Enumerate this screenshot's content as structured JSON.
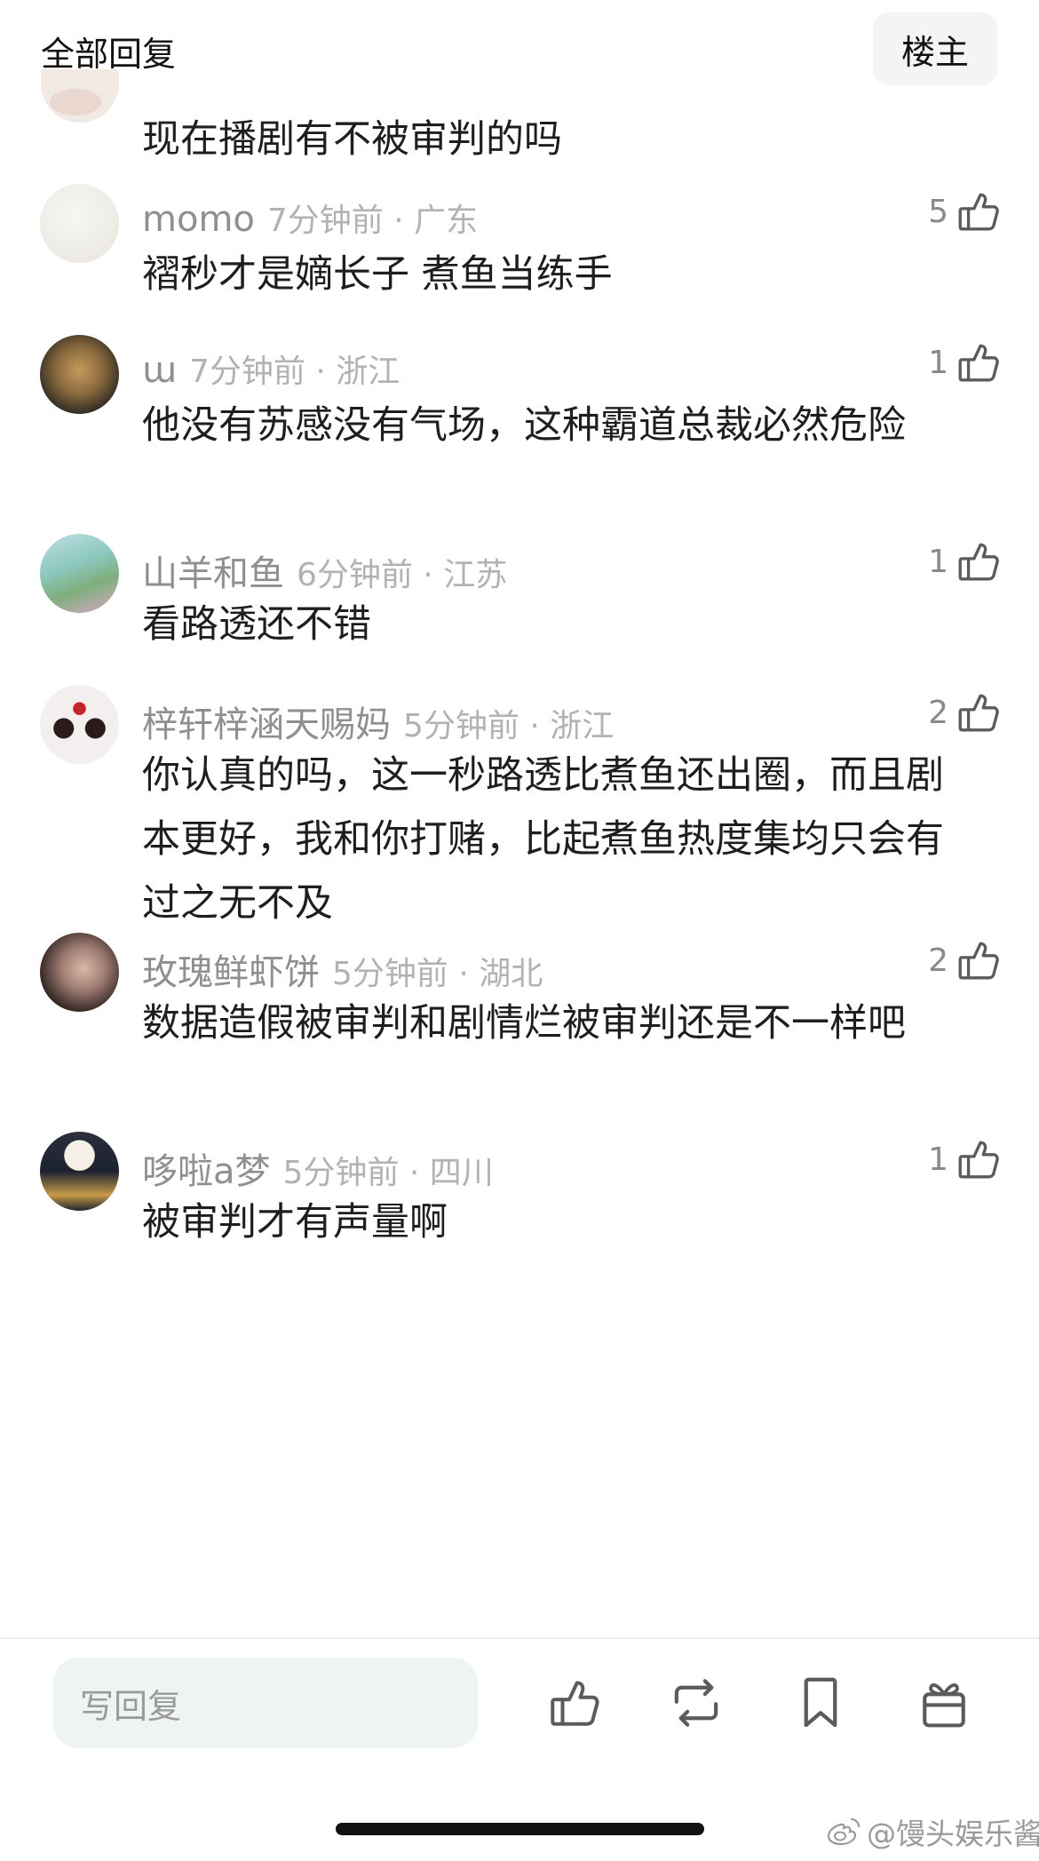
{
  "header": {
    "title": "全部回复",
    "op_label": "楼主"
  },
  "partial_comment": {
    "text": "现在播剧有不被审判的吗"
  },
  "comments": [
    {
      "username": "momo",
      "time_location": "7分钟前 · 广东",
      "likes": "5",
      "text": "褶秒才是嫡长子 煮鱼当练手"
    },
    {
      "username": "ɯ",
      "time_location": "7分钟前 · 浙江",
      "likes": "1",
      "text": "他没有苏感没有气场，这种霸道总裁必然危险"
    },
    {
      "username": "山羊和鱼",
      "time_location": "6分钟前 · 江苏",
      "likes": "1",
      "text": "看路透还不错"
    },
    {
      "username": "梓轩梓涵天赐妈",
      "time_location": "5分钟前 · 浙江",
      "likes": "2",
      "text": "你认真的吗，这一秒路透比煮鱼还出圈，而且剧本更好，我和你打赌，比起煮鱼热度集均只会有过之无不及"
    },
    {
      "username": "玫瑰鲜虾饼",
      "time_location": "5分钟前 · 湖北",
      "likes": "2",
      "text": "数据造假被审判和剧情烂被审判还是不一样吧"
    },
    {
      "username": "哆啦a梦",
      "time_location": "5分钟前 · 四川",
      "likes": "1",
      "text": "被审判才有声量啊"
    }
  ],
  "bottom_bar": {
    "reply_placeholder": "写回复",
    "icons": [
      "thumbs-up-icon",
      "repost-icon",
      "bookmark-icon",
      "gift-icon"
    ]
  },
  "watermark": {
    "text": "@馒头娱乐酱"
  }
}
